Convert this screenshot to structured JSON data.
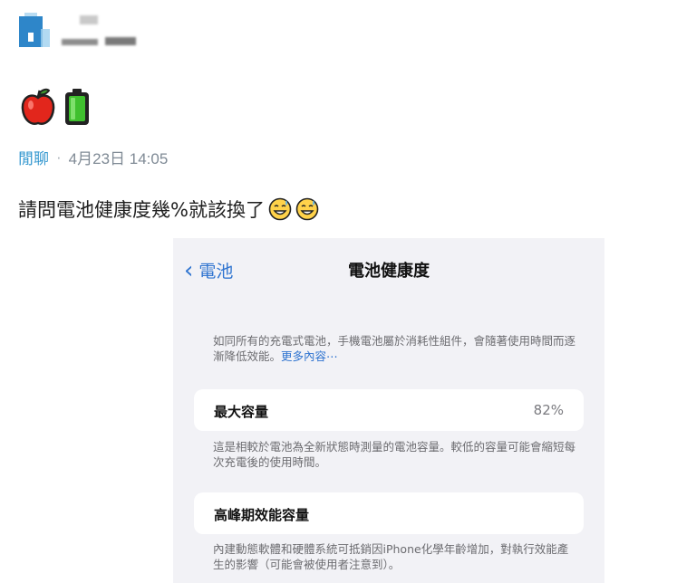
{
  "post": {
    "forum": "閒聊",
    "separator": "·",
    "date": "4月23日 14:05",
    "body": "請問電池健康度幾%就該換了",
    "emojis": [
      "apple-icon",
      "battery-icon",
      "grinning-sweat-icon"
    ]
  },
  "screenshot": {
    "back_label": "電池",
    "title": "電池健康度",
    "intro": "如同所有的充電式電池，手機電池屬於消耗性組件，會隨著使用時間而逐漸降低效能。",
    "more_link": "更多內容⋯",
    "max_capacity": {
      "label": "最大容量",
      "value": "82%",
      "description": "這是相較於電池為全新狀態時測量的電池容量。較低的容量可能會縮短每次充電後的使用時間。"
    },
    "peak_performance": {
      "label": "高峰期效能容量",
      "description": "內建動態軟體和硬體系統可抵銷因iPhone化學年齡增加，對執行效能產生的影響（可能會被使用者注意到）。"
    }
  },
  "colors": {
    "forum_link": "#3397cf",
    "ios_blue": "#2f74d0",
    "battery_green": "#3fc02e",
    "apple_red": "#e2261c"
  }
}
